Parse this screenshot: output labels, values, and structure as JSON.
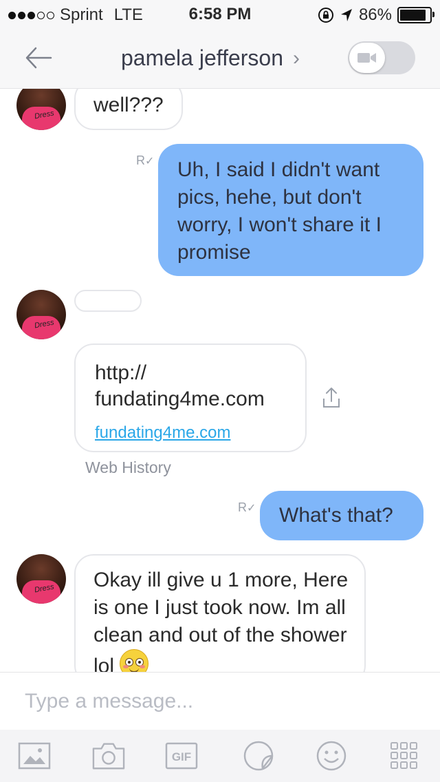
{
  "status_bar": {
    "carrier": "Sprint",
    "network": "LTE",
    "time": "6:58 PM",
    "battery_percent": "86%",
    "battery_level": 0.86,
    "signal_bars_filled": 3,
    "signal_bars_total": 5
  },
  "header": {
    "contact_name": "pamela jefferson",
    "chevron": "›",
    "video_toggle_on": false
  },
  "messages": [
    {
      "sender": "contact",
      "text": "well???"
    },
    {
      "sender": "me",
      "text": "Uh, I said I didn't want pics, hehe, but don't worry, I won't share it I promise",
      "receipt": "R"
    },
    {
      "sender": "contact",
      "text": ""
    },
    {
      "sender": "contact",
      "type": "link",
      "title": "http://\nfundating4me.com",
      "url": "fundating4me.com",
      "caption": "Web History"
    },
    {
      "sender": "me",
      "text": "What's that?",
      "receipt": "R"
    },
    {
      "sender": "contact",
      "text": "Okay ill give u 1 more, Here is one I just took now.  Im all clean and out of the shower lol"
    }
  ],
  "composer": {
    "placeholder": "Type a message..."
  },
  "toolbar": {
    "items": [
      {
        "icon": "image-icon"
      },
      {
        "icon": "camera-icon"
      },
      {
        "icon": "gif-icon",
        "label": "GIF"
      },
      {
        "icon": "sticker-icon"
      },
      {
        "icon": "smiley-icon"
      },
      {
        "icon": "more-grid-icon"
      }
    ]
  },
  "colors": {
    "outgoing_bubble": "#7fb6f9",
    "link": "#2aa7e8",
    "header_bg": "#f7f7f8"
  }
}
